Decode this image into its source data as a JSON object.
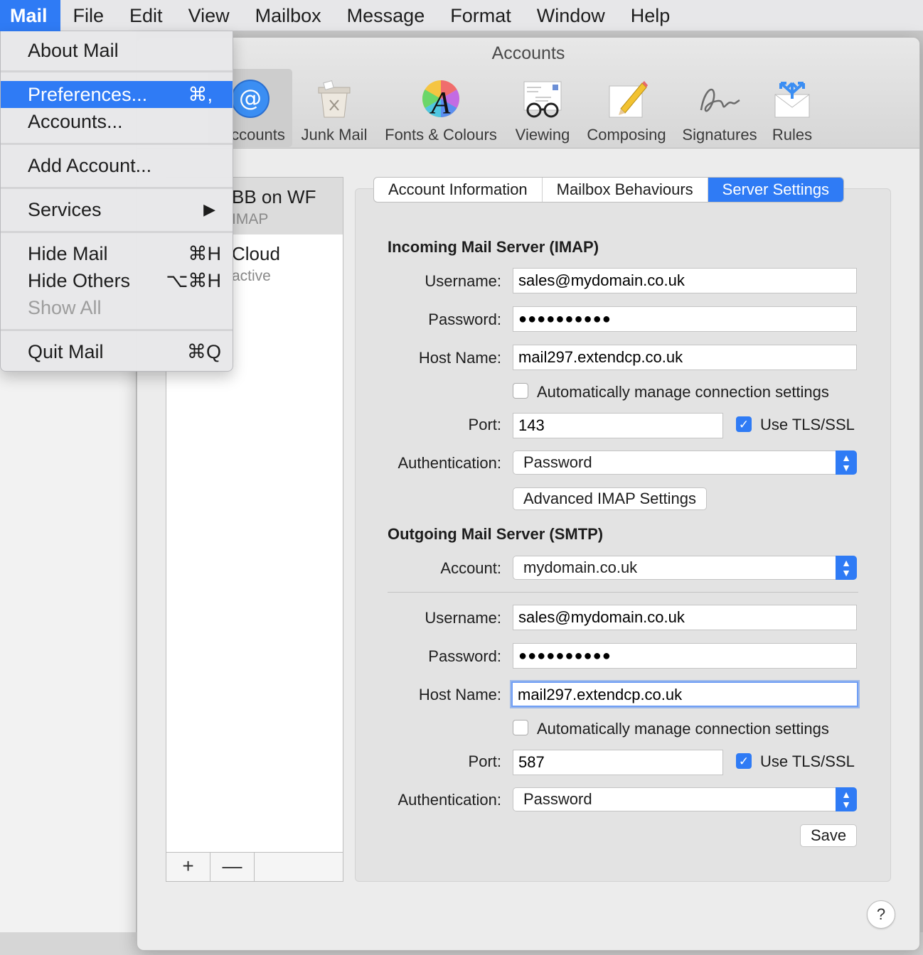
{
  "menubar": {
    "items": [
      "Mail",
      "File",
      "Edit",
      "View",
      "Mailbox",
      "Message",
      "Format",
      "Window",
      "Help"
    ]
  },
  "app_menu": {
    "about": "About Mail",
    "preferences": "Preferences...",
    "preferences_shortcut": "⌘,",
    "accounts": "Accounts...",
    "add_account": "Add Account...",
    "services": "Services",
    "services_arrow": "▶",
    "hide_mail": "Hide Mail",
    "hide_mail_shortcut": "⌘H",
    "hide_others": "Hide Others",
    "hide_others_shortcut": "⌥⌘H",
    "show_all": "Show All",
    "quit": "Quit Mail",
    "quit_shortcut": "⌘Q"
  },
  "window": {
    "title": "Accounts",
    "toolbar": [
      {
        "label": "Accounts",
        "visible_label": "ccounts",
        "icon": "at-sign-icon"
      },
      {
        "label": "Junk Mail",
        "icon": "trash-bin-icon"
      },
      {
        "label": "Fonts & Colours",
        "icon": "font-color-wheel-icon"
      },
      {
        "label": "Viewing",
        "icon": "glasses-icon"
      },
      {
        "label": "Composing",
        "icon": "pencil-paper-icon"
      },
      {
        "label": "Signatures",
        "icon": "signature-icon"
      },
      {
        "label": "Rules",
        "icon": "rules-envelope-icon"
      }
    ]
  },
  "accounts_list": {
    "items": [
      {
        "name": "BB on WF",
        "type": "IMAP"
      },
      {
        "name": "Cloud",
        "type": "active"
      }
    ],
    "add_label": "+",
    "remove_label": "—"
  },
  "tabs": [
    "Account Information",
    "Mailbox Behaviours",
    "Server Settings"
  ],
  "incoming": {
    "title": "Incoming Mail Server (IMAP)",
    "username_label": "Username:",
    "username": "sales@mydomain.co.uk",
    "password_label": "Password:",
    "password": "●●●●●●●●●●",
    "host_label": "Host Name:",
    "host": "mail297.extendcp.co.uk",
    "auto_manage": "Automatically manage connection settings",
    "auto_manage_checked": false,
    "port_label": "Port:",
    "port": "143",
    "tls_label": "Use TLS/SSL",
    "tls_checked": true,
    "auth_label": "Authentication:",
    "auth": "Password",
    "advanced_button": "Advanced IMAP Settings"
  },
  "outgoing": {
    "title": "Outgoing Mail Server (SMTP)",
    "account_label": "Account:",
    "account": "mydomain.co.uk",
    "username_label": "Username:",
    "username": "sales@mydomain.co.uk",
    "password_label": "Password:",
    "password": "●●●●●●●●●●",
    "host_label": "Host Name:",
    "host": "mail297.extendcp.co.uk",
    "auto_manage": "Automatically manage connection settings",
    "auto_manage_checked": false,
    "port_label": "Port:",
    "port": "587",
    "tls_label": "Use TLS/SSL",
    "tls_checked": true,
    "auth_label": "Authentication:",
    "auth": "Password"
  },
  "save_button": "Save",
  "help_button": "?",
  "colors": {
    "accent": "#2f7bf5",
    "window_bg": "#ececec",
    "panel_bg": "#e3e3e3"
  }
}
